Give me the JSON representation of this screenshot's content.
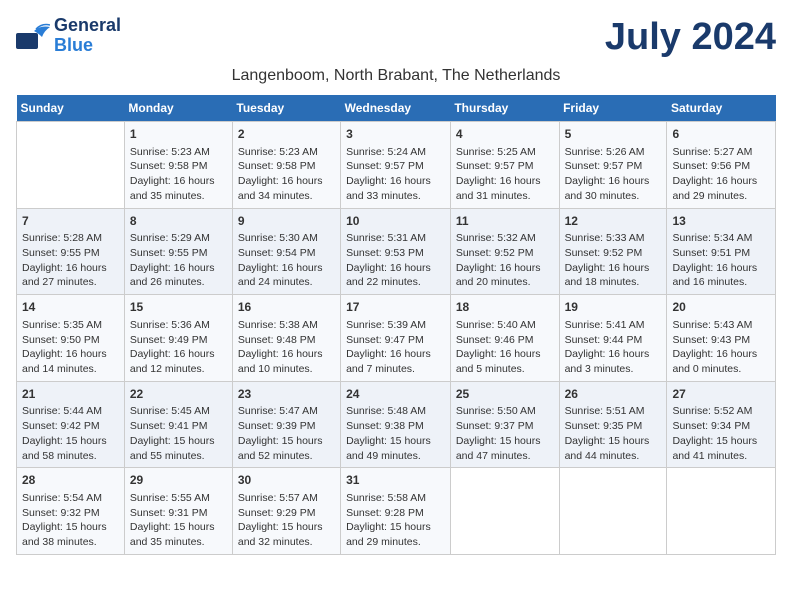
{
  "logo": {
    "line1": "General",
    "line2": "Blue"
  },
  "month": "July 2024",
  "location": "Langenboom, North Brabant, The Netherlands",
  "days_header": [
    "Sunday",
    "Monday",
    "Tuesday",
    "Wednesday",
    "Thursday",
    "Friday",
    "Saturday"
  ],
  "weeks": [
    [
      {
        "day": "",
        "content": ""
      },
      {
        "day": "1",
        "content": "Sunrise: 5:23 AM\nSunset: 9:58 PM\nDaylight: 16 hours\nand 35 minutes."
      },
      {
        "day": "2",
        "content": "Sunrise: 5:23 AM\nSunset: 9:58 PM\nDaylight: 16 hours\nand 34 minutes."
      },
      {
        "day": "3",
        "content": "Sunrise: 5:24 AM\nSunset: 9:57 PM\nDaylight: 16 hours\nand 33 minutes."
      },
      {
        "day": "4",
        "content": "Sunrise: 5:25 AM\nSunset: 9:57 PM\nDaylight: 16 hours\nand 31 minutes."
      },
      {
        "day": "5",
        "content": "Sunrise: 5:26 AM\nSunset: 9:57 PM\nDaylight: 16 hours\nand 30 minutes."
      },
      {
        "day": "6",
        "content": "Sunrise: 5:27 AM\nSunset: 9:56 PM\nDaylight: 16 hours\nand 29 minutes."
      }
    ],
    [
      {
        "day": "7",
        "content": "Sunrise: 5:28 AM\nSunset: 9:55 PM\nDaylight: 16 hours\nand 27 minutes."
      },
      {
        "day": "8",
        "content": "Sunrise: 5:29 AM\nSunset: 9:55 PM\nDaylight: 16 hours\nand 26 minutes."
      },
      {
        "day": "9",
        "content": "Sunrise: 5:30 AM\nSunset: 9:54 PM\nDaylight: 16 hours\nand 24 minutes."
      },
      {
        "day": "10",
        "content": "Sunrise: 5:31 AM\nSunset: 9:53 PM\nDaylight: 16 hours\nand 22 minutes."
      },
      {
        "day": "11",
        "content": "Sunrise: 5:32 AM\nSunset: 9:52 PM\nDaylight: 16 hours\nand 20 minutes."
      },
      {
        "day": "12",
        "content": "Sunrise: 5:33 AM\nSunset: 9:52 PM\nDaylight: 16 hours\nand 18 minutes."
      },
      {
        "day": "13",
        "content": "Sunrise: 5:34 AM\nSunset: 9:51 PM\nDaylight: 16 hours\nand 16 minutes."
      }
    ],
    [
      {
        "day": "14",
        "content": "Sunrise: 5:35 AM\nSunset: 9:50 PM\nDaylight: 16 hours\nand 14 minutes."
      },
      {
        "day": "15",
        "content": "Sunrise: 5:36 AM\nSunset: 9:49 PM\nDaylight: 16 hours\nand 12 minutes."
      },
      {
        "day": "16",
        "content": "Sunrise: 5:38 AM\nSunset: 9:48 PM\nDaylight: 16 hours\nand 10 minutes."
      },
      {
        "day": "17",
        "content": "Sunrise: 5:39 AM\nSunset: 9:47 PM\nDaylight: 16 hours\nand 7 minutes."
      },
      {
        "day": "18",
        "content": "Sunrise: 5:40 AM\nSunset: 9:46 PM\nDaylight: 16 hours\nand 5 minutes."
      },
      {
        "day": "19",
        "content": "Sunrise: 5:41 AM\nSunset: 9:44 PM\nDaylight: 16 hours\nand 3 minutes."
      },
      {
        "day": "20",
        "content": "Sunrise: 5:43 AM\nSunset: 9:43 PM\nDaylight: 16 hours\nand 0 minutes."
      }
    ],
    [
      {
        "day": "21",
        "content": "Sunrise: 5:44 AM\nSunset: 9:42 PM\nDaylight: 15 hours\nand 58 minutes."
      },
      {
        "day": "22",
        "content": "Sunrise: 5:45 AM\nSunset: 9:41 PM\nDaylight: 15 hours\nand 55 minutes."
      },
      {
        "day": "23",
        "content": "Sunrise: 5:47 AM\nSunset: 9:39 PM\nDaylight: 15 hours\nand 52 minutes."
      },
      {
        "day": "24",
        "content": "Sunrise: 5:48 AM\nSunset: 9:38 PM\nDaylight: 15 hours\nand 49 minutes."
      },
      {
        "day": "25",
        "content": "Sunrise: 5:50 AM\nSunset: 9:37 PM\nDaylight: 15 hours\nand 47 minutes."
      },
      {
        "day": "26",
        "content": "Sunrise: 5:51 AM\nSunset: 9:35 PM\nDaylight: 15 hours\nand 44 minutes."
      },
      {
        "day": "27",
        "content": "Sunrise: 5:52 AM\nSunset: 9:34 PM\nDaylight: 15 hours\nand 41 minutes."
      }
    ],
    [
      {
        "day": "28",
        "content": "Sunrise: 5:54 AM\nSunset: 9:32 PM\nDaylight: 15 hours\nand 38 minutes."
      },
      {
        "day": "29",
        "content": "Sunrise: 5:55 AM\nSunset: 9:31 PM\nDaylight: 15 hours\nand 35 minutes."
      },
      {
        "day": "30",
        "content": "Sunrise: 5:57 AM\nSunset: 9:29 PM\nDaylight: 15 hours\nand 32 minutes."
      },
      {
        "day": "31",
        "content": "Sunrise: 5:58 AM\nSunset: 9:28 PM\nDaylight: 15 hours\nand 29 minutes."
      },
      {
        "day": "",
        "content": ""
      },
      {
        "day": "",
        "content": ""
      },
      {
        "day": "",
        "content": ""
      }
    ]
  ]
}
